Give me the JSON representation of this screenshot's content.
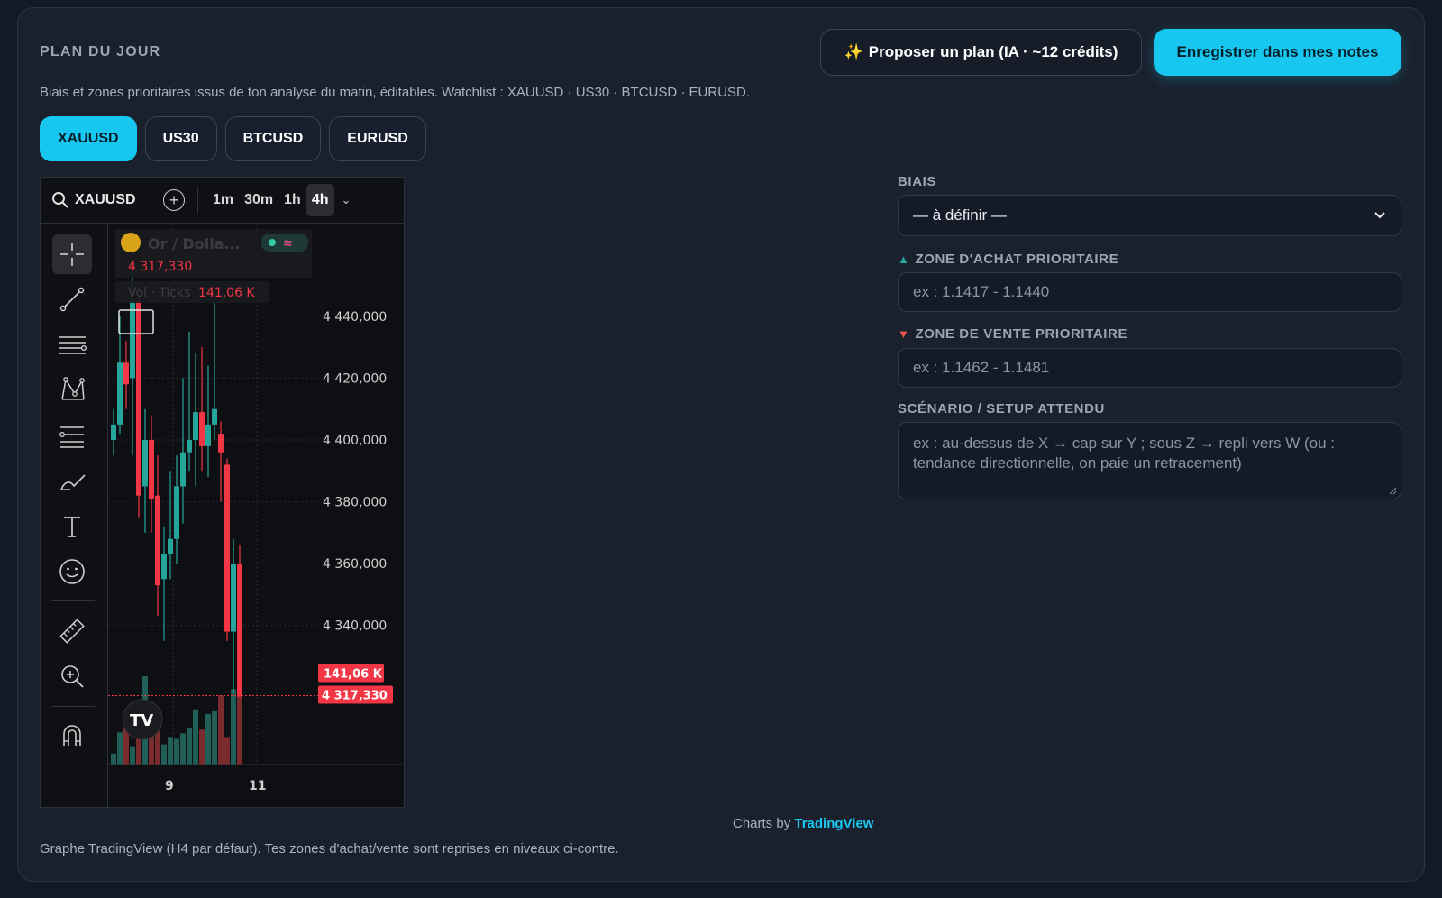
{
  "header": {
    "title": "PLAN DU JOUR",
    "subtitle": "Biais et zones prioritaires issus de ton analyse du matin, éditables. Watchlist : XAUUSD · US30 · BTCUSD · EURUSD.",
    "propose_button": "Proposer un plan (IA · ~12 crédits)",
    "propose_icon": "sparkles-icon",
    "save_button": "Enregistrer dans mes notes"
  },
  "tabs": [
    {
      "label": "XAUUSD",
      "active": true
    },
    {
      "label": "US30",
      "active": false
    },
    {
      "label": "BTCUSD",
      "active": false
    },
    {
      "label": "EURUSD",
      "active": false
    }
  ],
  "widget": {
    "symbol": "XAUUSD",
    "timeframes": [
      "1m",
      "30m",
      "1h",
      "4h"
    ],
    "active_timeframe": "4h",
    "legend_price": "4 317,330",
    "legend_name": "Or / Dolla...",
    "legend_volume_label": "Vol · Ticks",
    "legend_volume": "141,06 K",
    "volume_badge": "141,06 K",
    "price_badge": "4 317,330",
    "tools": [
      "crosshair-icon",
      "trend-line-icon",
      "horizontal-lines-icon",
      "pattern-icon",
      "fib-icon",
      "brush-icon",
      "text-icon",
      "emoji-icon",
      "ruler-icon",
      "zoom-in-icon",
      "magnet-icon"
    ]
  },
  "chart_data": {
    "type": "candlestick",
    "symbol": "XAUUSD",
    "interval": "4h",
    "y_ticks": [
      "4 440,000",
      "4 420,000",
      "4 400,000",
      "4 380,000",
      "4 360,000",
      "4 340,000"
    ],
    "x_ticks": [
      "9",
      "11"
    ],
    "ylim": [
      4295,
      4470
    ],
    "last_price": 4317.33,
    "candles": [
      {
        "o": 4400,
        "h": 4410,
        "l": 4395,
        "c": 4405
      },
      {
        "o": 4405,
        "h": 4440,
        "l": 4402,
        "c": 4425
      },
      {
        "o": 4425,
        "h": 4432,
        "l": 4410,
        "c": 4418
      },
      {
        "o": 4420,
        "h": 4455,
        "l": 4395,
        "c": 4445
      },
      {
        "o": 4445,
        "h": 4450,
        "l": 4375,
        "c": 4382
      },
      {
        "o": 4385,
        "h": 4410,
        "l": 4370,
        "c": 4400
      },
      {
        "o": 4400,
        "h": 4408,
        "l": 4370,
        "c": 4381
      },
      {
        "o": 4382,
        "h": 4395,
        "l": 4343,
        "c": 4353
      },
      {
        "o": 4355,
        "h": 4372,
        "l": 4335,
        "c": 4363
      },
      {
        "o": 4363,
        "h": 4390,
        "l": 4355,
        "c": 4368
      },
      {
        "o": 4368,
        "h": 4395,
        "l": 4360,
        "c": 4385
      },
      {
        "o": 4385,
        "h": 4420,
        "l": 4373,
        "c": 4396
      },
      {
        "o": 4396,
        "h": 4435,
        "l": 4390,
        "c": 4400
      },
      {
        "o": 4400,
        "h": 4428,
        "l": 4385,
        "c": 4409
      },
      {
        "o": 4409,
        "h": 4430,
        "l": 4390,
        "c": 4398
      },
      {
        "o": 4398,
        "h": 4424,
        "l": 4388,
        "c": 4405
      },
      {
        "o": 4405,
        "h": 4447,
        "l": 4400,
        "c": 4410
      },
      {
        "o": 4402,
        "h": 4406,
        "l": 4380,
        "c": 4396
      },
      {
        "o": 4392,
        "h": 4394,
        "l": 4335,
        "c": 4338
      },
      {
        "o": 4338,
        "h": 4368,
        "l": 4318,
        "c": 4360
      },
      {
        "o": 4360,
        "h": 4366,
        "l": 4317,
        "c": 4317
      }
    ],
    "volumes": [
      12,
      35,
      40,
      20,
      42,
      96,
      50,
      38,
      22,
      30,
      28,
      34,
      40,
      60,
      38,
      55,
      58,
      75,
      30,
      82,
      98
    ]
  },
  "form": {
    "bias_label": "BIAIS",
    "bias_value": "— à définir —",
    "buy_label": "ZONE D'ACHAT PRIORITAIRE",
    "buy_placeholder": "ex : 1.1417 - 1.1440",
    "sell_label": "ZONE DE VENTE PRIORITAIRE",
    "sell_placeholder": "ex : 1.1462 - 1.1481",
    "scenario_label": "SCÉNARIO / SETUP ATTENDU",
    "scenario_placeholder": "ex : au-dessus de X → cap sur Y ; sous Z → repli vers W (ou : tendance directionnelle, on paie un retracement)"
  },
  "footer": {
    "credits_prefix": "Charts by",
    "credits_brand": "TradingView",
    "note": "Graphe TradingView (H4 par défaut). Tes zones d'achat/vente sont reprises en niveaux ci-contre."
  },
  "colors": {
    "accent": "#18c7f0",
    "up": "#26a69a",
    "down": "#f23645"
  }
}
